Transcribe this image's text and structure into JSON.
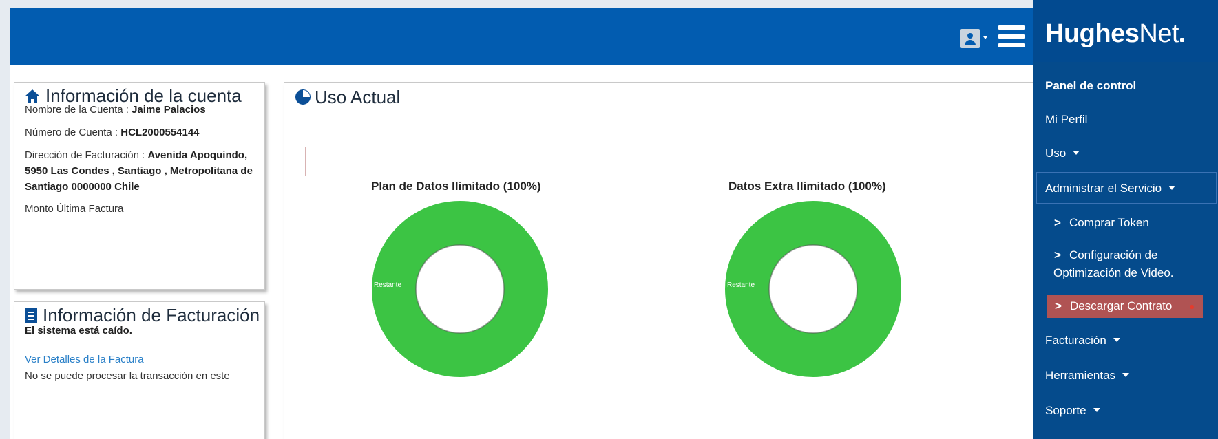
{
  "header": {
    "user_icon": "user-icon",
    "menu_icon": "hamburger-icon"
  },
  "account": {
    "title": "Información de la cuenta",
    "name_label": "Nombre de la Cuenta : ",
    "name_value": "Jaime Palacios",
    "number_label": "Número de Cuenta : ",
    "number_value": "HCL2000554144",
    "address_label": "Dirección de Facturación : ",
    "address_line1": "Avenida Apoquindo,",
    "address_line2": "5950 Las Condes , Santiago , Metropolitana de",
    "address_line3": "Santiago 0000000 Chile",
    "last_invoice_label": "Monto Última Factura"
  },
  "billing": {
    "title": "Información de Facturación",
    "status": "El sistema está caído.",
    "details_link": "Ver Detalles de la Factura",
    "message_line1": "No se puede procesar la transacción en este"
  },
  "usage": {
    "title": "Uso Actual",
    "charts": [
      {
        "title": "Plan de Datos Ilimitado (100%)",
        "slice_label": "Restante",
        "remaining_percent": 100
      },
      {
        "title": "Datos Extra Ilimitado (100%)",
        "slice_label": "Restante",
        "remaining_percent": 100
      }
    ]
  },
  "colors": {
    "header": "#025cb0",
    "sidebar": "#054b8c",
    "donut": "#3cc444",
    "highlight": "#b05353"
  },
  "sidebar": {
    "brand_bold": "Hughes",
    "brand_light": "Net",
    "items": {
      "panel": "Panel de control",
      "profile": "Mi Perfil",
      "usage": "Uso",
      "manage": "Administrar el Servicio",
      "buy_token": "Comprar Token",
      "video_opt_1": "Configuración de",
      "video_opt_2": "Optimización de Video.",
      "download_contract": "Descargar Contrato",
      "billing": "Facturación",
      "tools": "Herramientas",
      "support": "Soporte"
    },
    "sub_prefix": ">"
  }
}
